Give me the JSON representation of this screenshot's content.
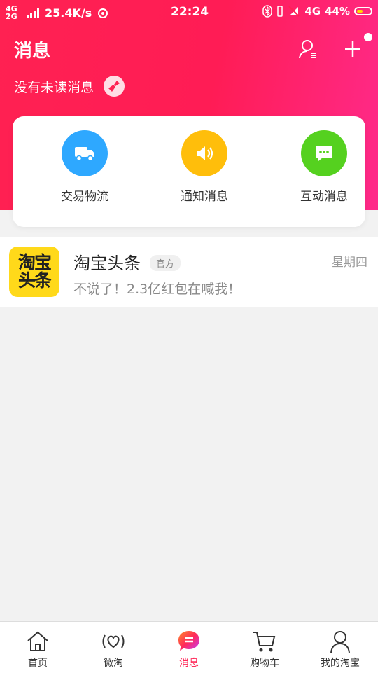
{
  "status": {
    "net_top": "4G",
    "net_bottom": "2G",
    "speed": "25.4K/s",
    "time": "22:24",
    "network": "4G",
    "battery": "44%"
  },
  "header": {
    "title": "消息",
    "subtitle": "没有未读消息"
  },
  "categories": [
    {
      "label": "交易物流",
      "color": "#2ea8ff",
      "icon": "truck-icon"
    },
    {
      "label": "通知消息",
      "color": "#ffbe0b",
      "icon": "speaker-icon"
    },
    {
      "label": "互动消息",
      "color": "#55d11f",
      "icon": "chat-bubble-icon"
    }
  ],
  "messages": [
    {
      "logo_line1": "淘宝",
      "logo_line2": "头条",
      "name": "淘宝头条",
      "tag": "官方",
      "date": "星期四",
      "text": "不说了！2.3亿红包在喊我！"
    }
  ],
  "tabs": [
    {
      "label": "首页",
      "icon": "home-icon"
    },
    {
      "label": "微淘",
      "icon": "heart-wave-icon"
    },
    {
      "label": "消息",
      "icon": "message-icon",
      "active": true
    },
    {
      "label": "购物车",
      "icon": "cart-icon"
    },
    {
      "label": "我的淘宝",
      "icon": "person-icon"
    }
  ],
  "colors": {
    "accent": "#ff1f55",
    "active_tab": "#ff2a5a"
  }
}
